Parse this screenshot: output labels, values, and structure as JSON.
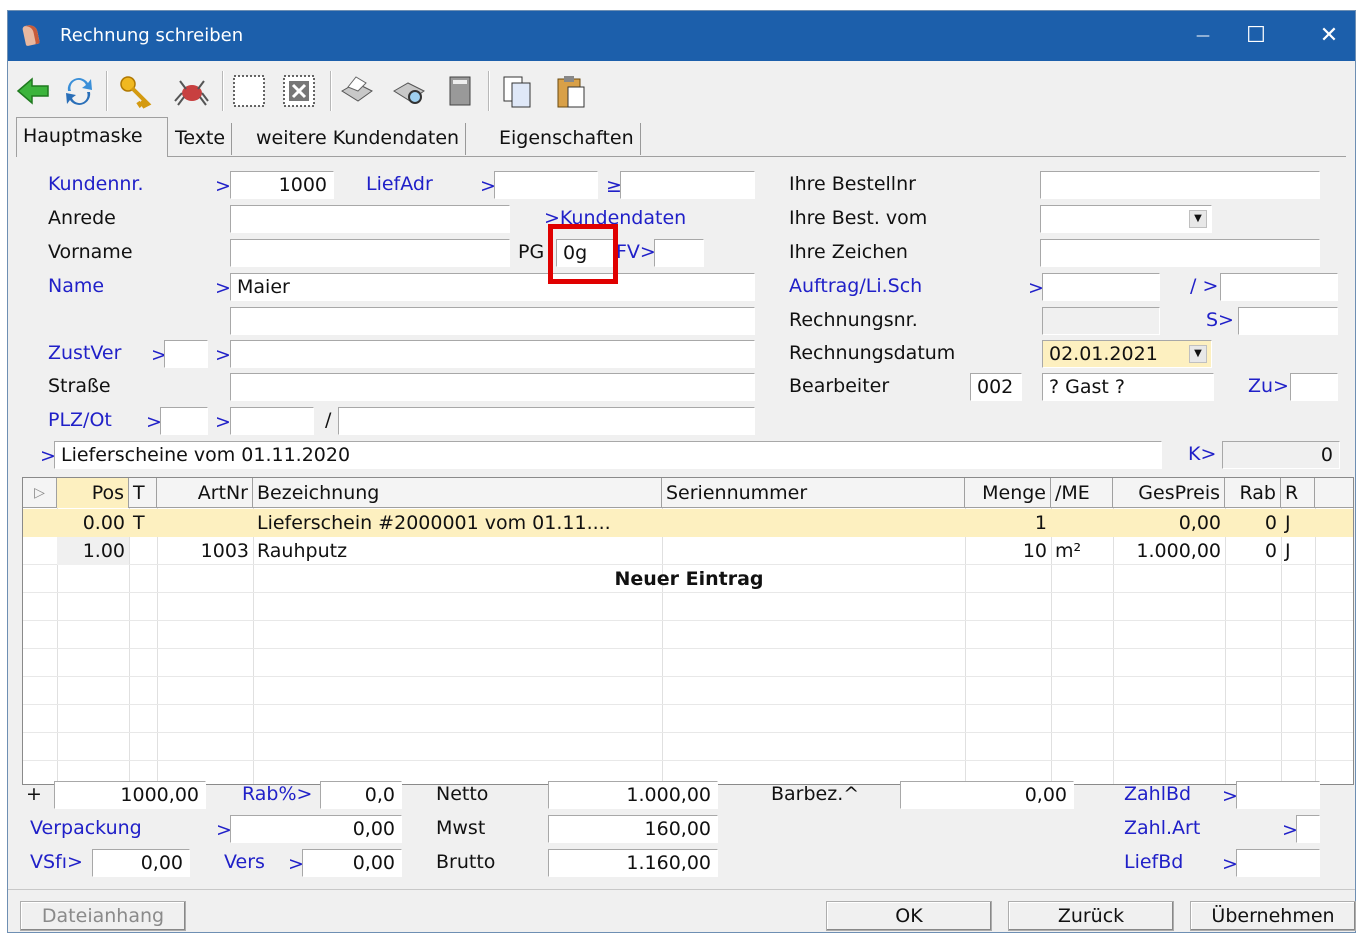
{
  "window": {
    "title": "Rechnung schreiben",
    "maximize": "☐",
    "close": "✕"
  },
  "toolbar": {
    "icons": [
      "back-arrow-icon",
      "refresh-icon",
      "key-icon",
      "search-spider-icon",
      "new-blank-icon",
      "delete-icon",
      "print-icon",
      "print-preview-icon",
      "export-icon",
      "copy-icon",
      "paste-icon"
    ]
  },
  "tabs": [
    {
      "label": "Hauptmaske"
    },
    {
      "label": "Texte"
    },
    {
      "label": "weitere Kundendaten"
    },
    {
      "label": "Eigenschaften"
    }
  ],
  "form": {
    "kundennr_label": "Kundennr.",
    "kundennr_value": "1000",
    "liefadr_label": "LiefAdr",
    "anrede_label": "Anrede",
    "kundendaten_link": ">Kundendaten",
    "vorname_label": "Vorname",
    "pg_label": "PG",
    "pg_value": "0g",
    "fv_label": "FV>",
    "name_label": "Name",
    "name_value": "Maier",
    "zustver_label": "ZustVer",
    "strasse_label": "Straße",
    "plz_label": "PLZ/Ot",
    "slash": "/",
    "lieferschein_text": "Lieferscheine vom 01.11.2020",
    "k_label": "K>",
    "k_value": "0",
    "bestellnr_label": "Ihre Bestellnr",
    "best_vom_label": "Ihre Best. vom",
    "zeichen_label": "Ihre Zeichen",
    "auftrag_label": "Auftrag/Li.Sch",
    "auftrag_slash": "/ >",
    "rechnungsnr_label": "Rechnungsnr.",
    "s_label": "S>",
    "rechnungsdatum_label": "Rechnungsdatum",
    "rechnungsdatum_value": "02.01.2021",
    "bearbeiter_label": "Bearbeiter",
    "bearbeiter_code": "002",
    "bearbeiter_name": "? Gast ?",
    "zu_label": "Zu>"
  },
  "grid": {
    "columns": [
      "Pos",
      "T",
      "ArtNr",
      "Bezeichnung",
      "Seriennummer",
      "Menge",
      "/ME",
      "GesPreis",
      "Rab",
      "R"
    ],
    "rows": [
      {
        "pos": "0.00",
        "t": "T",
        "artnr": "",
        "bez": "Lieferschein #2000001 vom 01.11....",
        "serien": "",
        "menge": "1",
        "me": "",
        "gespreis": "0,00",
        "rab": "0",
        "r": "J"
      },
      {
        "pos": "1.00",
        "t": "",
        "artnr": "1003",
        "bez": "Rauhputz",
        "serien": "",
        "menge": "10",
        "me": "m²",
        "gespreis": "1.000,00",
        "rab": "0",
        "r": "J"
      }
    ],
    "new_entry": "Neuer Eintrag"
  },
  "totals": {
    "plus": "+",
    "sum_value": "1000,00",
    "rab_label": "Rab%>",
    "rab_value": "0,0",
    "netto_label": "Netto",
    "netto_value": "1.000,00",
    "barbez_label": "Barbez.^",
    "barbez_value": "0,00",
    "zahlbd_label": "ZahlBd",
    "verpackung_label": "Verpackung",
    "verpackung_value": "0,00",
    "mwst_label": "Mwst",
    "mwst_value": "160,00",
    "zahlart_label": "Zahl.Art",
    "vsfr_label": "VSfı>",
    "vsfr_value": "0,00",
    "vers_label": "Vers",
    "vers_value": "0,00",
    "brutto_label": "Brutto",
    "brutto_value": "1.160,00",
    "liefbd_label": "LiefBd"
  },
  "buttons": {
    "dateianhang": "Dateianhang",
    "ok": "OK",
    "zurueck": "Zurück",
    "uebernehmen": "Übernehmen"
  },
  "colors": {
    "titlebar": "#1c5fab",
    "link": "#2020c8",
    "highlight_row": "#fdf0c0",
    "annotation": "#e00000"
  }
}
